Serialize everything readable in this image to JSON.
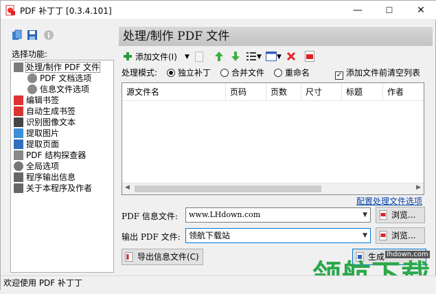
{
  "window": {
    "title": "PDF 补丁丁 [0.3.4.101]",
    "minimize": "—",
    "maximize": "☐",
    "close": "✕"
  },
  "left": {
    "label": "选择功能:",
    "toolbar_icons": [
      "documents-icon",
      "save-icon",
      "info-icon"
    ],
    "tree": [
      {
        "label": "处理/制作 PDF 文件",
        "indent": 0,
        "icon": "document-icon",
        "color": "#7a7a7a",
        "selected": true
      },
      {
        "label": "PDF 文档选项",
        "indent": 1,
        "icon": "gear-icon",
        "color": "#8a8a8a"
      },
      {
        "label": "信息文件选项",
        "indent": 1,
        "icon": "gear-icon",
        "color": "#8a8a8a"
      },
      {
        "label": "编辑书签",
        "indent": 0,
        "icon": "bookmark-icon",
        "color": "#d33"
      },
      {
        "label": "自动生成书签",
        "indent": 0,
        "icon": "bookmark-icon",
        "color": "#d33"
      },
      {
        "label": "识别图像文本",
        "indent": 0,
        "icon": "ocr-icon",
        "color": "#444"
      },
      {
        "label": "提取图片",
        "indent": 0,
        "icon": "image-icon",
        "color": "#3a8fd6"
      },
      {
        "label": "提取页面",
        "indent": 0,
        "icon": "page-icon",
        "color": "#2f6fbd"
      },
      {
        "label": "PDF 结构探查器",
        "indent": 0,
        "icon": "explorer-icon",
        "color": "#888"
      },
      {
        "label": "全局选项",
        "indent": 0,
        "icon": "gear-icon",
        "color": "#777"
      },
      {
        "label": "程序输出信息",
        "indent": 0,
        "icon": "log-icon",
        "color": "#666"
      },
      {
        "label": "关于本程序及作者",
        "indent": 0,
        "icon": "mail-icon",
        "color": "#666"
      }
    ]
  },
  "main": {
    "header": "处理/制作 PDF 文件",
    "toolbar": {
      "add_files": "添加文件(I)"
    },
    "mode": {
      "label": "处理模式:",
      "options": [
        "独立补丁",
        "合并文件",
        "重命名"
      ],
      "selected": 0,
      "clear_list": "添加文件前清空列表",
      "clear_list_checked": true
    },
    "columns": [
      "源文件名",
      "页码",
      "页数",
      "尺寸",
      "标题",
      "作者"
    ],
    "config_link": "配置处理文件选项",
    "info_file": {
      "label": "PDF 信息文件:",
      "value": "www.LHdown.com",
      "browse": "浏览..."
    },
    "output_file": {
      "label": "输出 PDF 文件:",
      "value": "领航下载站",
      "browse": "浏览..."
    },
    "export_button": "导出信息文件(C)",
    "generate_button": "生成"
  },
  "status": "欢迎使用 PDF 补丁丁",
  "watermark": {
    "text": "领航下载",
    "site": "lhdown.com",
    "color": "#2aa84a"
  }
}
